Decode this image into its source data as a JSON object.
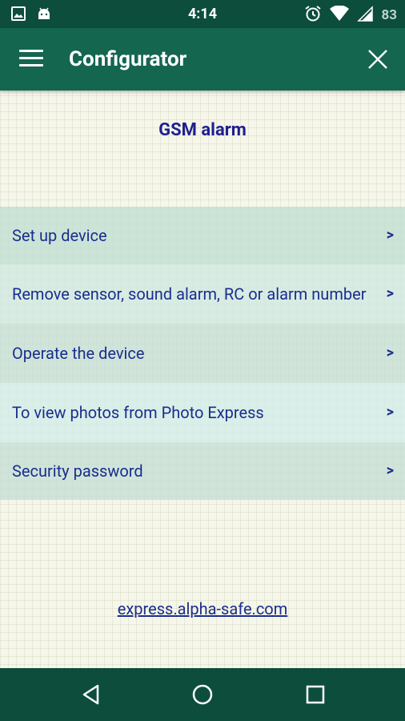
{
  "status_bar": {
    "time": "4:14",
    "battery": "83",
    "left_icons": [
      "image-icon",
      "android-icon"
    ],
    "right_icons": [
      "alarm-clock-icon",
      "wifi-icon",
      "signal-icon"
    ]
  },
  "app_bar": {
    "title": "Configurator",
    "menu_icon": "hamburger-menu-icon",
    "close_icon": "close-icon"
  },
  "main": {
    "section_title": "GSM alarm",
    "menu_items": [
      {
        "label": "Set up device",
        "arrow": ">"
      },
      {
        "label": "Remove sensor, sound alarm, RC or alarm number",
        "arrow": ">"
      },
      {
        "label": "Operate the device",
        "arrow": ">"
      },
      {
        "label": "To view photos from Photo Express",
        "arrow": ">"
      },
      {
        "label": "Security password",
        "arrow": ">"
      }
    ],
    "link": "express.alpha-safe.com"
  },
  "nav_bar": {
    "buttons": [
      "back-icon",
      "home-icon",
      "recents-icon"
    ]
  },
  "colors": {
    "status_bar": "#0d4d3c",
    "app_bar": "#14664f",
    "text_primary": "#1a2e8e",
    "title": "#1f1f8e"
  }
}
